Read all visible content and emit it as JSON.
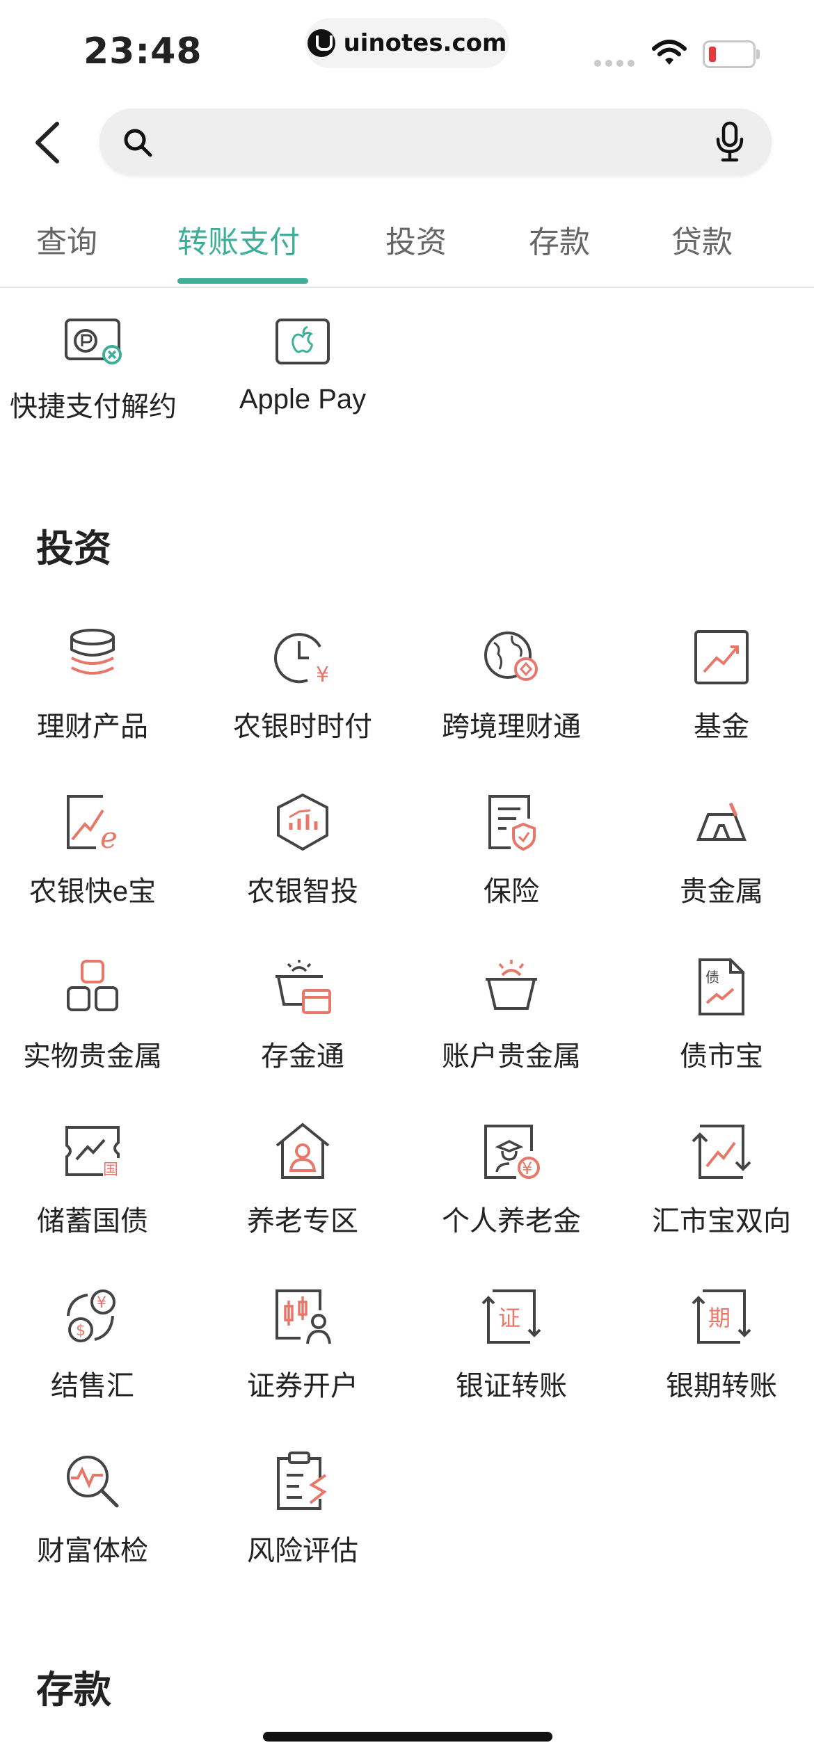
{
  "status_bar": {
    "time": "23:48",
    "url": "uinotes.com"
  },
  "search": {
    "placeholder": ""
  },
  "tabs": [
    {
      "label": "查询"
    },
    {
      "label": "转账支付",
      "active": true
    },
    {
      "label": "投资"
    },
    {
      "label": "存款"
    },
    {
      "label": "贷款"
    }
  ],
  "accent_color": "#3fae98",
  "icon_red": "#e8776a",
  "payment_items": [
    {
      "label": "快捷支付解约",
      "icon": "payment-cancel-icon"
    },
    {
      "label": "Apple Pay",
      "icon": "apple-pay-icon"
    }
  ],
  "invest_section": {
    "title": "投资",
    "items": [
      {
        "label": "理财产品",
        "icon": "coin-stack-icon"
      },
      {
        "label": "农银时时付",
        "icon": "clock-yen-icon"
      },
      {
        "label": "跨境理财通",
        "icon": "globe-icon"
      },
      {
        "label": "基金",
        "icon": "fund-chart-icon"
      },
      {
        "label": "农银快e宝",
        "icon": "chart-e-icon"
      },
      {
        "label": "农银智投",
        "icon": "hexagon-chart-icon"
      },
      {
        "label": "保险",
        "icon": "insurance-doc-icon"
      },
      {
        "label": "贵金属",
        "icon": "gold-bar-icon"
      },
      {
        "label": "实物贵金属",
        "icon": "gold-blocks-icon"
      },
      {
        "label": "存金通",
        "icon": "gold-basket-card-icon"
      },
      {
        "label": "账户贵金属",
        "icon": "gold-basket-icon"
      },
      {
        "label": "债市宝",
        "icon": "bond-doc-icon"
      },
      {
        "label": "储蓄国债",
        "icon": "treasury-ticket-icon"
      },
      {
        "label": "养老专区",
        "icon": "house-person-icon"
      },
      {
        "label": "个人养老金",
        "icon": "pension-card-icon"
      },
      {
        "label": "汇市宝双向",
        "icon": "two-way-chart-icon"
      },
      {
        "label": "结售汇",
        "icon": "currency-exchange-icon"
      },
      {
        "label": "证券开户",
        "icon": "candlestick-person-icon"
      },
      {
        "label": "银证转账",
        "icon": "securities-transfer-icon"
      },
      {
        "label": "银期转账",
        "icon": "futures-transfer-icon"
      },
      {
        "label": "财富体检",
        "icon": "wealth-check-icon"
      },
      {
        "label": "风险评估",
        "icon": "risk-clipboard-icon"
      }
    ]
  },
  "deposit_section": {
    "title": "存款"
  },
  "glyphs": {
    "bond": "债",
    "treasury": "国",
    "securities": "证",
    "futures": "期",
    "yen": "¥",
    "dollar": "$"
  }
}
